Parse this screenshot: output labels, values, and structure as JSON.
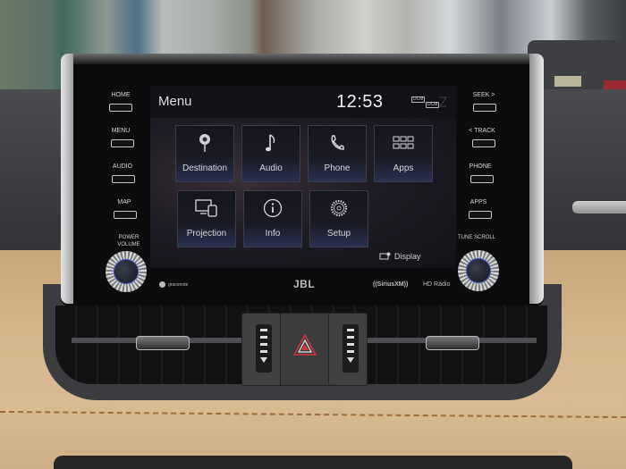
{
  "screen": {
    "title": "Menu",
    "clock": "12:53",
    "status_icons": [
      {
        "name": "dcm-icon",
        "label": "DCM"
      },
      {
        "name": "dcm-signal-icon",
        "label": "DCM"
      },
      {
        "name": "no-signal-icon",
        "label": ""
      }
    ],
    "tiles": [
      {
        "id": "destination",
        "label": "Destination",
        "icon": "map-pin-icon"
      },
      {
        "id": "audio",
        "label": "Audio",
        "icon": "music-note-icon"
      },
      {
        "id": "phone",
        "label": "Phone",
        "icon": "phone-icon"
      },
      {
        "id": "apps",
        "label": "Apps",
        "icon": "grid-icon"
      },
      {
        "id": "projection",
        "label": "Projection",
        "icon": "projection-icon"
      },
      {
        "id": "info",
        "label": "Info",
        "icon": "info-icon"
      },
      {
        "id": "setup",
        "label": "Setup",
        "icon": "gear-icon"
      }
    ],
    "display_button": {
      "label": "Display",
      "icon": "display-icon"
    }
  },
  "hardware": {
    "left_buttons": [
      {
        "label": "HOME"
      },
      {
        "label": "MENU"
      },
      {
        "label": "AUDIO"
      },
      {
        "label": "MAP"
      }
    ],
    "right_buttons": [
      {
        "label": "SEEK >"
      },
      {
        "label": "< TRACK"
      },
      {
        "label": "PHONE"
      },
      {
        "label": "APPS"
      }
    ],
    "left_knob_label": "POWER VOLUME",
    "right_knob_label": "TUNE SCROLL"
  },
  "brands": {
    "left": "gracenote",
    "center": "JBL",
    "sirius": "((SiriusXM))",
    "hd": "HD Radio"
  },
  "colors": {
    "hazard": "#d8343c",
    "leather": "#d6b68d",
    "stitch": "#9d6c3a",
    "knob_ring": "#4059c4"
  }
}
